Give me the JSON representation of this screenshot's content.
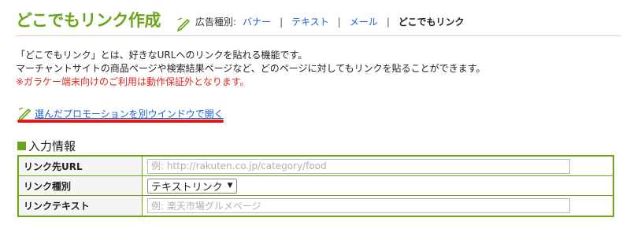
{
  "header": {
    "title": "どこでもリンク作成",
    "type_label": "広告種別:",
    "tabs": [
      {
        "label": "バナー"
      },
      {
        "label": "テキスト"
      },
      {
        "label": "メール"
      },
      {
        "label": "どこでもリンク"
      }
    ],
    "separator": "|"
  },
  "description": {
    "line1": "「どこでもリンク」とは、好きなURLへのリンクを貼れる機能です。",
    "line2": "マーチャントサイトの商品ページや検索結果ページなど、どのページに対してもリンクを貼ることができます。",
    "warning": "※ガラケー端末向けのご利用は動作保証外となります。"
  },
  "promo_link": "選んだプロモーションを別ウインドウで開く",
  "section_title": "入力情報",
  "form": {
    "url_label": "リンク先URL",
    "url_placeholder": "例: http://rakuten.co.jp/category/food",
    "type_label": "リンク種別",
    "type_value": "テキストリンク",
    "text_label": "リンクテキスト",
    "text_placeholder": "例: 楽天市場グルメページ"
  },
  "colors": {
    "accent_green": "#6aa519",
    "link_blue": "#1a5fd0",
    "warning_red": "#e0261d",
    "highlight_red": "#e31919"
  },
  "icons": {
    "title_icon": "pen-icon",
    "promo_icon": "pen-icon"
  }
}
